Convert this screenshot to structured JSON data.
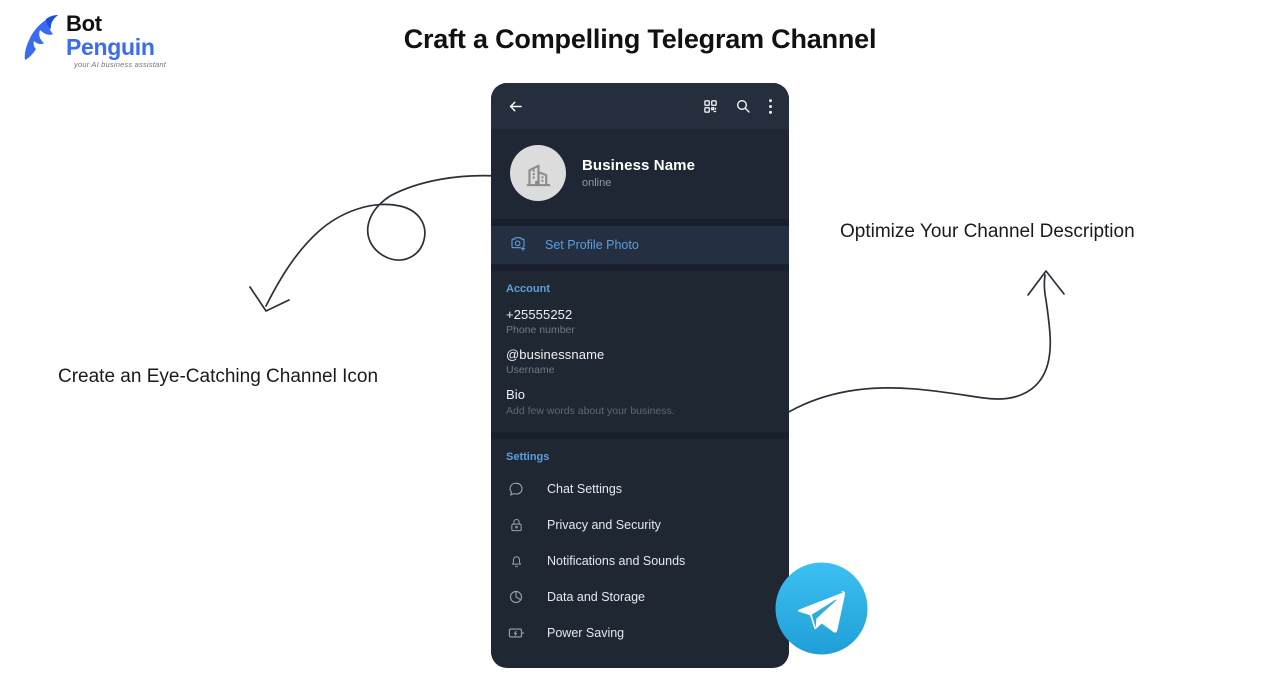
{
  "brand": {
    "name_top": "Bot",
    "name_bottom": "Penguin",
    "tagline": "your AI business assistant",
    "mark_icon": "penguin-logo-icon",
    "accent_color": "#3a6bf0"
  },
  "page": {
    "title": "Craft a Compelling Telegram Channel",
    "background_color": "#ffffff",
    "text_color": "#111111"
  },
  "annotations": [
    {
      "id": "left",
      "text": "Create an Eye-Catching Channel Icon",
      "arrow": "looping-curved-arrow-pointing-down-left",
      "points_to": "avatar"
    },
    {
      "id": "right",
      "text": "Optimize Your Channel Description",
      "arrow": "s-curved-arrow-pointing-up",
      "points_to": "bio-field"
    }
  ],
  "phone": {
    "background_color": "#1f2733",
    "header": {
      "background_color": "#242e3d",
      "back_icon": "back-arrow-icon",
      "qr_icon": "qr-scan-icon",
      "search_icon": "search-icon",
      "menu_icon": "more-vertical-icon"
    },
    "profile": {
      "avatar_icon": "building-icon",
      "avatar_background": "#dcdcdc",
      "name": "Business Name",
      "status": "online"
    },
    "set_profile_photo": {
      "icon": "camera-add-icon",
      "label": "Set Profile Photo",
      "accent_color": "#5b9ede"
    },
    "account_section": {
      "title": "Account",
      "fields": [
        {
          "value": "+25555252",
          "label": "Phone number"
        },
        {
          "value": "@businessname",
          "label": "Username"
        },
        {
          "value": "Bio",
          "placeholder": "Add few words about your business."
        }
      ]
    },
    "settings_section": {
      "title": "Settings",
      "items": [
        {
          "icon": "chat-bubble-icon",
          "label": "Chat Settings"
        },
        {
          "icon": "lock-icon",
          "label": "Privacy and Security"
        },
        {
          "icon": "bell-icon",
          "label": "Notifications and Sounds"
        },
        {
          "icon": "pie-chart-icon",
          "label": "Data and Storage"
        },
        {
          "icon": "battery-bolt-icon",
          "label": "Power Saving"
        }
      ]
    }
  },
  "telegram_badge": {
    "icon": "telegram-logo-icon",
    "color_light": "#37bbf0",
    "color_dark": "#2095d0"
  }
}
